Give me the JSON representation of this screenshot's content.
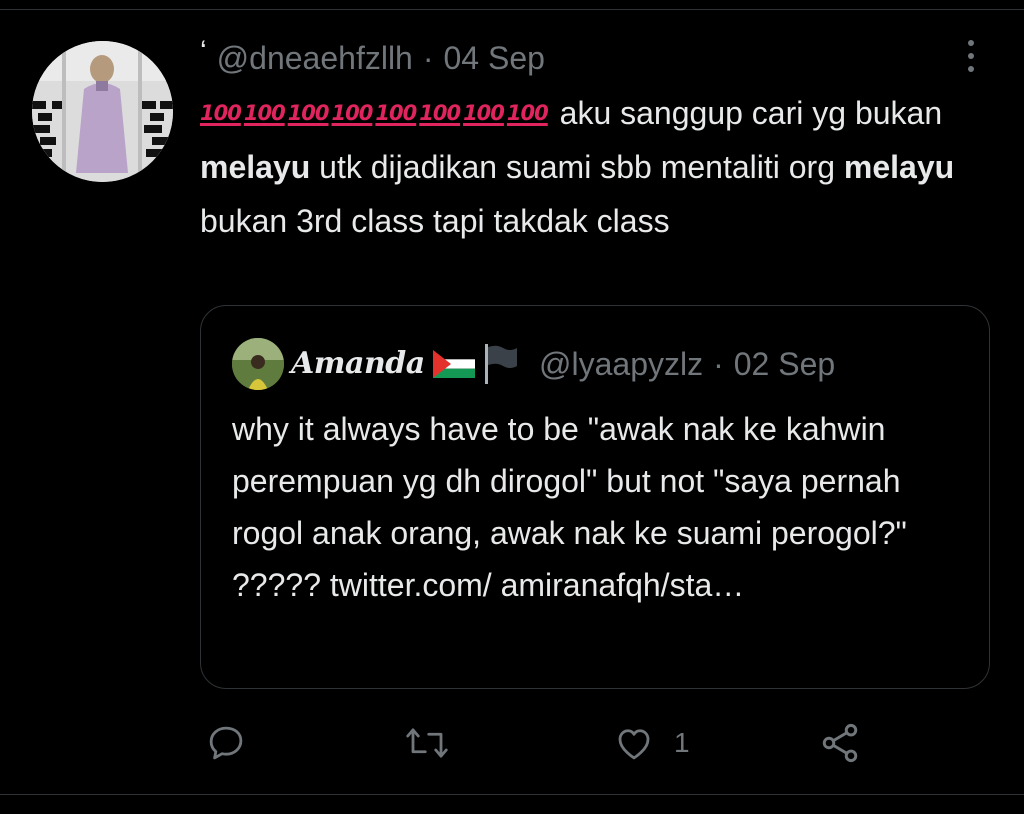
{
  "tweet": {
    "author_mark": "‘",
    "handle": "@dneaehfzllh",
    "separator": "·",
    "date": "04 Sep",
    "emoji_label": "100",
    "text_part1": "aku sanggup cari yg bukan",
    "bold_word": "melayu",
    "text_part2": "utk dijadikan suami sbb mentaliti org",
    "text_part3": "bukan 3rd class tapi takdak class"
  },
  "quote": {
    "display_name": "Amanda",
    "handle": "@lyaapyzlz",
    "separator": "·",
    "date": "02 Sep",
    "text": "why it always have to be \"awak nak ke kahwin perempuan yg dh dirogol\" but not \"saya pernah rogol anak orang, awak nak ke suami perogol?\"   ????? twitter.com/ amiranafqh/sta…"
  },
  "actions": {
    "like_count": "1",
    "icons": [
      "reply-icon",
      "retweet-icon",
      "like-icon",
      "share-icon"
    ]
  },
  "colors": {
    "background": "#000000",
    "text": "#e7e9ea",
    "muted": "#71767b",
    "border": "#2f3336",
    "hundred_red": "#e0245e"
  }
}
